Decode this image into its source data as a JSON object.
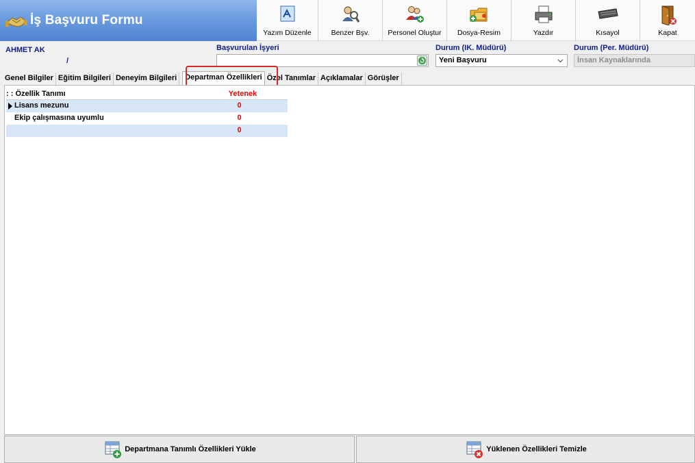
{
  "header": {
    "title": "İş Başvuru Formu"
  },
  "toolbar": {
    "buttons": [
      {
        "label": "Yazım Düzenle",
        "icon": "edit-document-icon"
      },
      {
        "label": "Benzer Bşv.",
        "icon": "search-people-icon"
      },
      {
        "label": "Personel Oluştur",
        "icon": "add-user-icon"
      },
      {
        "label": "Dosya-Resim",
        "icon": "folder-image-icon"
      },
      {
        "label": "Yazdır",
        "icon": "printer-icon"
      },
      {
        "label": "Kısayol",
        "icon": "keyboard-icon"
      },
      {
        "label": "Kapat",
        "icon": "exit-door-icon"
      }
    ]
  },
  "info": {
    "applicant_name": "AHMET AK",
    "applicant_sub": "/",
    "workplace_label": "Başvurulan İşyeri",
    "workplace_value": "",
    "status_hr_label": "Durum (IK. Müdürü)",
    "status_hr_value": "Yeni Başvuru",
    "status_pm_label": "Durum (Per. Müdürü)",
    "status_pm_value": "İnsan Kaynaklarında"
  },
  "tabs": [
    {
      "label": "Genel Bilgiler",
      "active": false
    },
    {
      "label": "Eğitim Bilgileri",
      "active": false
    },
    {
      "label": "Deneyim Bilgileri",
      "active": false
    },
    {
      "label": "Departman Özellikleri",
      "active": true
    },
    {
      "label": "Özel Tanımlar",
      "active": false
    },
    {
      "label": "Açıklamalar",
      "active": false
    },
    {
      "label": "Görüşler",
      "active": false
    }
  ],
  "grid": {
    "columns": {
      "name": ": : Özellik Tanımı",
      "value": "Yetenek"
    },
    "rows": [
      {
        "name": "Lisans mezunu",
        "value": "0"
      },
      {
        "name": "Ekip çalışmasına uyumlu",
        "value": "0"
      },
      {
        "name": "",
        "value": "0"
      }
    ]
  },
  "actions": {
    "load_label": "Departmana Tanımlı Özellikleri Yükle",
    "clear_label": "Yüklenen Özellikleri Temizle"
  },
  "colors": {
    "title_bar": "#6d9ce0",
    "label_blue": "#0b1e8c",
    "value_red": "#e00000",
    "highlight": "#d9262b",
    "row_alt": "#d7e7f8"
  }
}
